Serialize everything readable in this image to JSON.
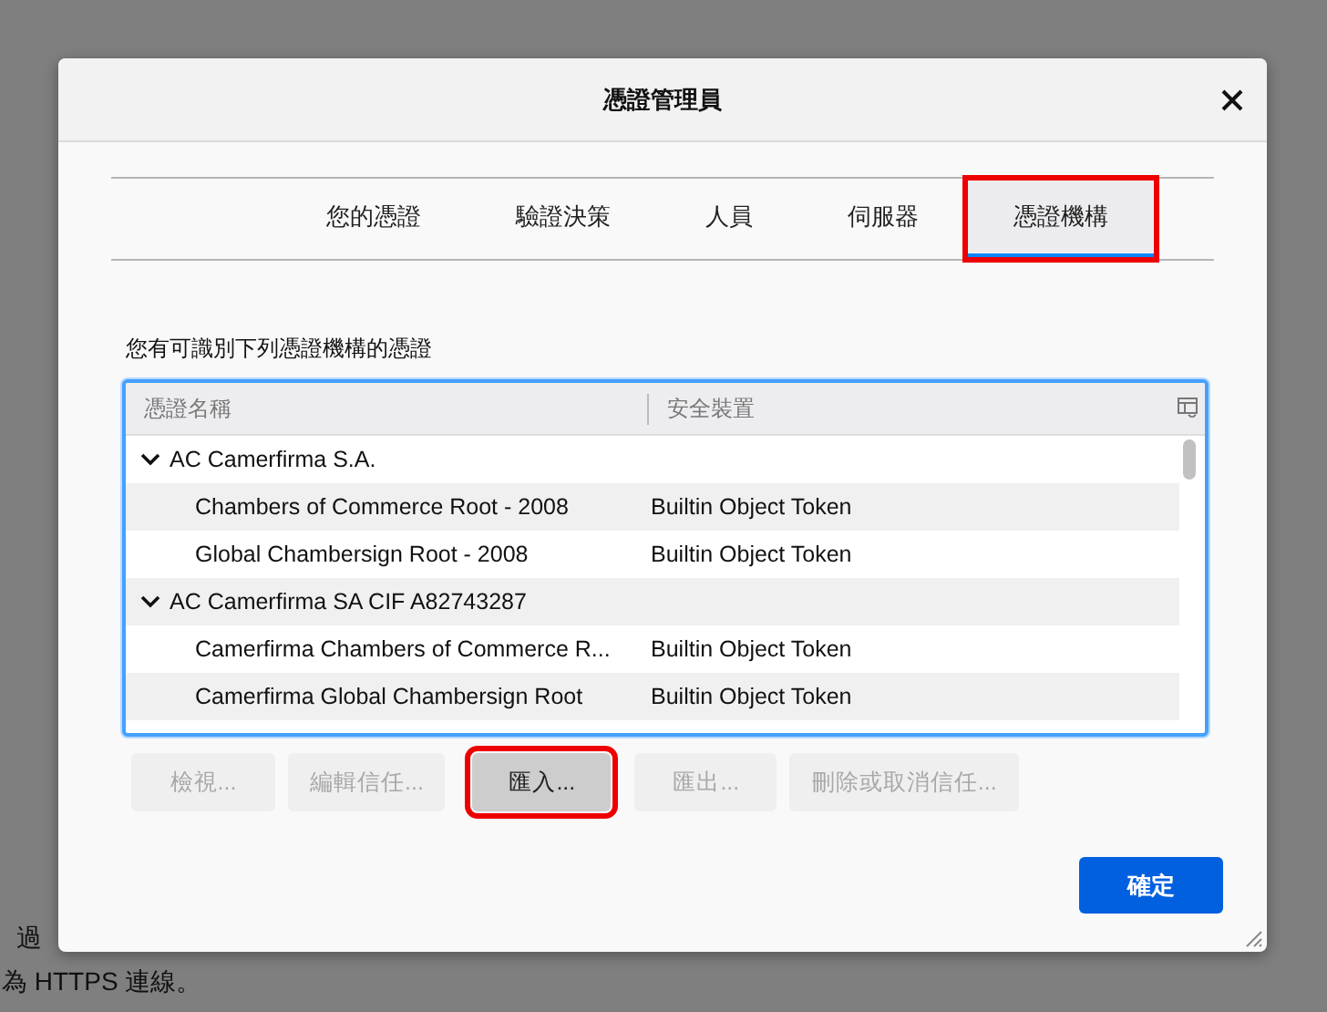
{
  "background_page": {
    "lines": [
      "過",
      "為 HTTPS 連線。"
    ]
  },
  "dialog": {
    "title": "憑證管理員"
  },
  "tabs": [
    {
      "label": "您的憑證",
      "selected": false,
      "highlighted": false
    },
    {
      "label": "驗證決策",
      "selected": false,
      "highlighted": false
    },
    {
      "label": "人員",
      "selected": false,
      "highlighted": false
    },
    {
      "label": "伺服器",
      "selected": false,
      "highlighted": false
    },
    {
      "label": "憑證機構",
      "selected": true,
      "highlighted": true
    }
  ],
  "description": "您有可識別下列憑證機構的憑證",
  "table": {
    "columns": [
      "憑證名稱",
      "安全裝置"
    ],
    "groups": [
      {
        "name": "AC Camerfirma S.A.",
        "expanded": true,
        "children": [
          {
            "name": "Chambers of Commerce Root - 2008",
            "device": "Builtin Object Token"
          },
          {
            "name": "Global Chambersign Root - 2008",
            "device": "Builtin Object Token"
          }
        ]
      },
      {
        "name": "AC Camerfirma SA CIF A82743287",
        "expanded": true,
        "children": [
          {
            "name": "Camerfirma Chambers of Commerce R...",
            "device": "Builtin Object Token"
          },
          {
            "name": "Camerfirma Global Chambersign Root",
            "device": "Builtin Object Token"
          }
        ]
      }
    ]
  },
  "buttons": [
    {
      "label": "檢視...",
      "disabled": true,
      "highlighted": false
    },
    {
      "label": "編輯信任...",
      "disabled": true,
      "highlighted": false
    },
    {
      "label": "匯入...",
      "disabled": false,
      "highlighted": true
    },
    {
      "label": "匯出...",
      "disabled": true,
      "highlighted": false
    },
    {
      "label": "刪除或取消信任...",
      "disabled": true,
      "highlighted": false
    }
  ],
  "ok_button": "確定"
}
